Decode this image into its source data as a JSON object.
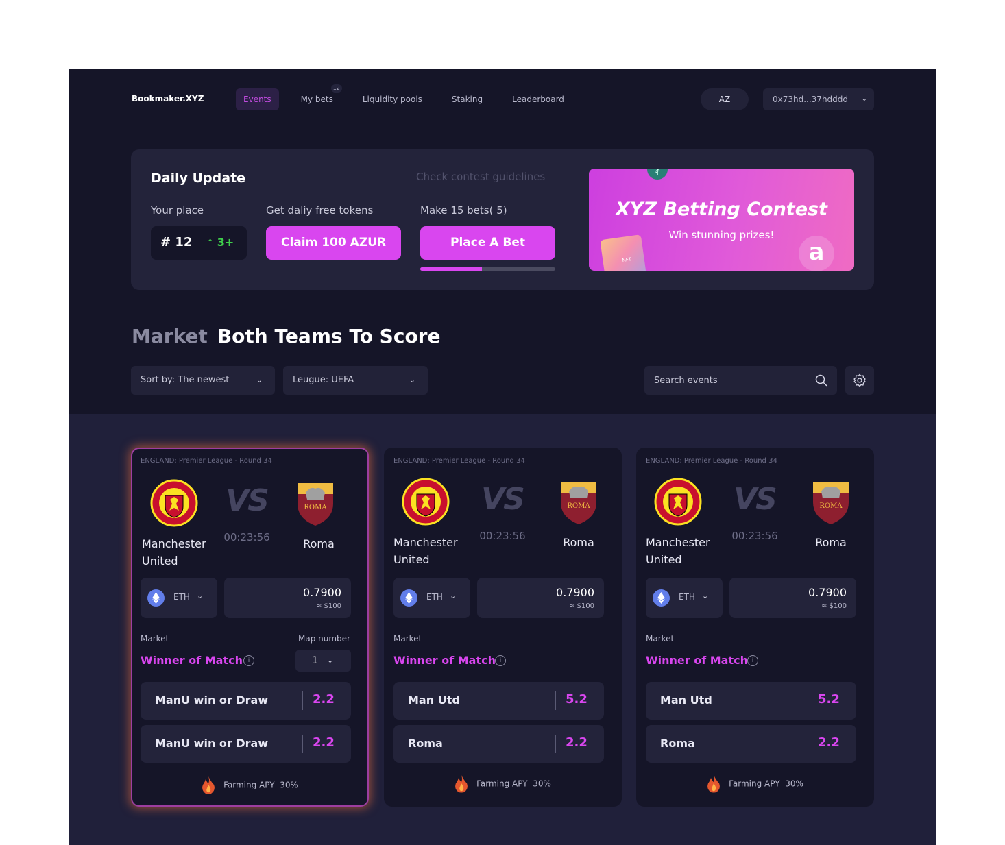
{
  "header": {
    "logo": "Bookmaker.XYZ",
    "nav": [
      {
        "label": "Events"
      },
      {
        "label": "My bets",
        "badge": "12"
      },
      {
        "label": "Liquidity pools"
      },
      {
        "label": "Staking"
      },
      {
        "label": "Leaderboard"
      }
    ],
    "language": "AZ",
    "wallet": "0x73hd...37hdddd"
  },
  "daily": {
    "title": "Daily Update",
    "guidelines": "Check contest guidelines",
    "your_place_label": "Your place",
    "place": "# 12",
    "place_change": "3+",
    "free_tokens_label": "Get daliy free tokens",
    "claim_button": "Claim 100  AZUR",
    "bets_label": "Make 15 bets( 5)",
    "place_bet_button": "Place A Bet",
    "progress_fraction": 0.455
  },
  "contest": {
    "title": "XYZ Betting Contest",
    "subtitle": "Win stunning prizes!",
    "nft_tag": "NFT"
  },
  "market": {
    "label": "Market",
    "name": "Both Teams To Score",
    "sort": "Sort by: The newest",
    "league": "Leugue: UEFA",
    "search_placeholder": "Search events"
  },
  "cards": [
    {
      "league": "ENGLAND: Premier League - Round 34",
      "home": "Manchester United",
      "away": "Roma",
      "vs": "VS",
      "timer": "00:23:56",
      "coin": "ETH",
      "amount": "0.7900",
      "usd": "≈ $100",
      "market_label": "Market",
      "map_label": "Map number",
      "map_value": "1",
      "market_value": "Winner of Match",
      "odds": [
        {
          "label": "ManU win or Draw",
          "value": "2.2"
        },
        {
          "label": "ManU win or Draw",
          "value": "2.2"
        }
      ],
      "farming_label": "Farming APY",
      "farming_value": "30%"
    },
    {
      "league": "ENGLAND: Premier League - Round 34",
      "home": "Manchester United",
      "away": "Roma",
      "vs": "VS",
      "timer": "00:23:56",
      "coin": "ETH",
      "amount": "0.7900",
      "usd": "≈ $100",
      "market_label": "Market",
      "market_value": "Winner of Match",
      "odds": [
        {
          "label": "Man Utd",
          "value": "5.2"
        },
        {
          "label": "Roma",
          "value": "2.2"
        }
      ],
      "farming_label": "Farming APY",
      "farming_value": "30%"
    },
    {
      "league": "ENGLAND: Premier League - Round 34",
      "home": "Manchester United",
      "away": "Roma",
      "vs": "VS",
      "timer": "00:23:56",
      "coin": "ETH",
      "amount": "0.7900",
      "usd": "≈ $100",
      "market_label": "Market",
      "market_value": "Winner of Match",
      "odds": [
        {
          "label": "Man Utd",
          "value": "5.2"
        },
        {
          "label": "Roma",
          "value": "2.2"
        }
      ],
      "farming_label": "Farming APY",
      "farming_value": "30%"
    }
  ],
  "crest_text": {
    "manu_top": "MANCHESTER",
    "manu_bottom": "UNITED",
    "roma": "ROMA",
    "roma_year": "1927"
  },
  "colors": {
    "accent": "#d946ef",
    "positive": "#3fcf4c",
    "background": "#151528",
    "panel": "#23233a"
  }
}
